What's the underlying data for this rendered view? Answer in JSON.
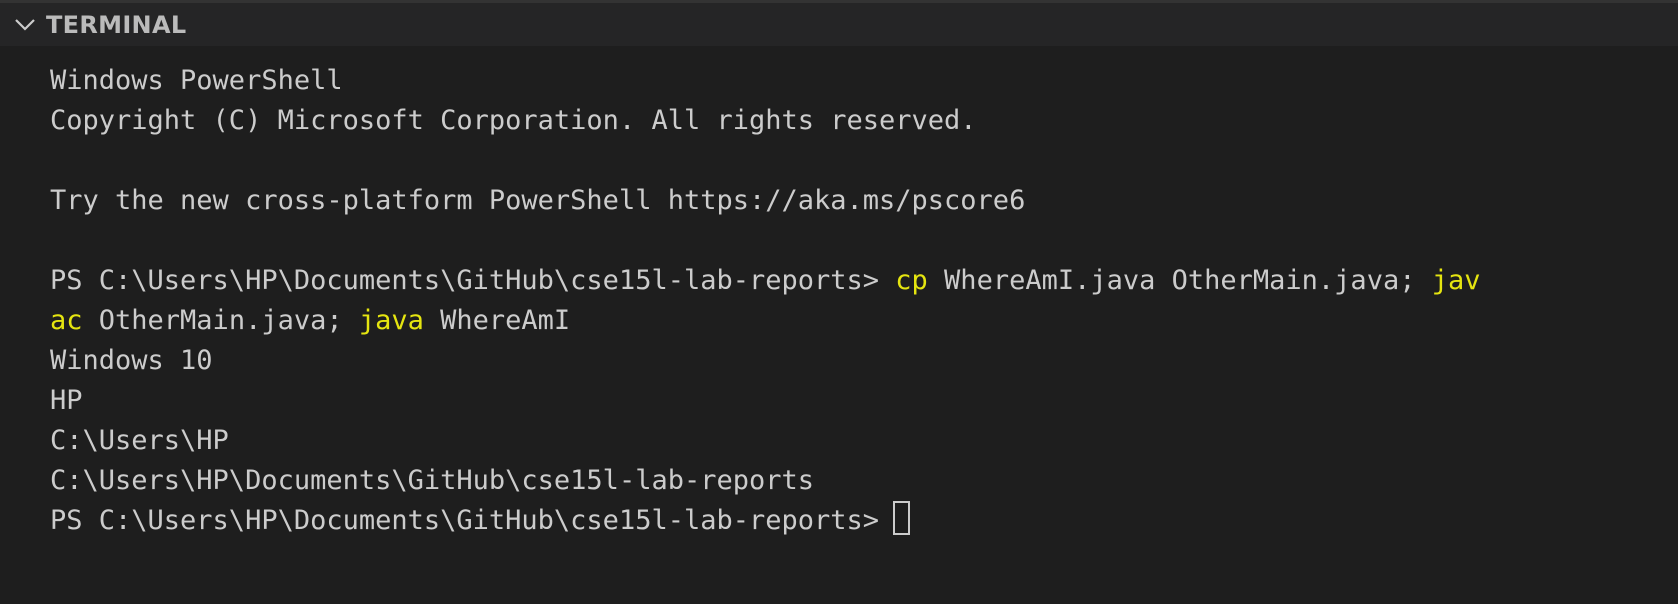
{
  "panel": {
    "title": "TERMINAL",
    "chevron_icon": "chevron-down-icon"
  },
  "terminal": {
    "banner_line1": "Windows PowerShell",
    "banner_line2": "Copyright (C) Microsoft Corporation. All rights reserved.",
    "banner_line3": "Try the new cross-platform PowerShell https://aka.ms/pscore6",
    "prompt": "PS C:\\Users\\HP\\Documents\\GitHub\\cse15l-lab-reports> ",
    "command": {
      "cp": "cp",
      "cp_args": " WhereAmI.java OtherMain.java; ",
      "javac_part1": "jav",
      "javac_part2": "ac",
      "javac_args": " OtherMain.java; ",
      "java": "java",
      "java_args": " WhereAmI"
    },
    "output": [
      "Windows 10",
      "HP",
      "C:\\Users\\HP",
      "C:\\Users\\HP\\Documents\\GitHub\\cse15l-lab-reports"
    ],
    "final_prompt": "PS C:\\Users\\HP\\Documents\\GitHub\\cse15l-lab-reports>"
  },
  "colors": {
    "background": "#1e1e1e",
    "header_background": "#252526",
    "text": "#cccccc",
    "command_highlight": "#e5e510"
  }
}
